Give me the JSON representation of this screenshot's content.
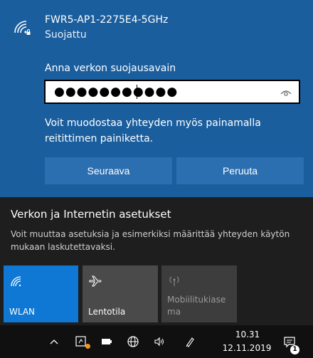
{
  "network": {
    "ssid": "FWR5-AP1-2275E4-5GHz",
    "status": "Suojattu",
    "key_label": "Anna verkon suojausavain",
    "password_mask": "●●●●●●●●●●●",
    "hint": "Voit muodostaa yhteyden myös painamalla reitittimen painiketta.",
    "next_label": "Seuraava",
    "cancel_label": "Peruuta"
  },
  "settings": {
    "title": "Verkon ja Internetin asetukset",
    "description": "Voit muuttaa asetuksia ja esimerkiksi määrittää yhteyden käytön mukaan laskutettavaksi."
  },
  "tiles": [
    {
      "label": "WLAN",
      "icon": "wifi-icon",
      "active": true
    },
    {
      "label": "Lentotila",
      "icon": "airplane-icon",
      "active": false
    },
    {
      "label": "Mobiilitukiase ma",
      "icon": "hotspot-icon",
      "active": false,
      "disabled": true
    }
  ],
  "taskbar": {
    "time": "10.31",
    "date": "12.11.2019",
    "notification_count": "1",
    "icons": [
      "chevron-up-icon",
      "notification-app-icon",
      "battery-icon",
      "network-globe-icon",
      "volume-icon",
      "pen-icon",
      "action-center-icon"
    ]
  },
  "colors": {
    "panel_blue": "#1b5e9e",
    "button_blue": "#2c6fb0",
    "tile_active": "#0f78d4",
    "flyout_bg": "#1e1e1e",
    "taskbar_bg": "#101010"
  }
}
